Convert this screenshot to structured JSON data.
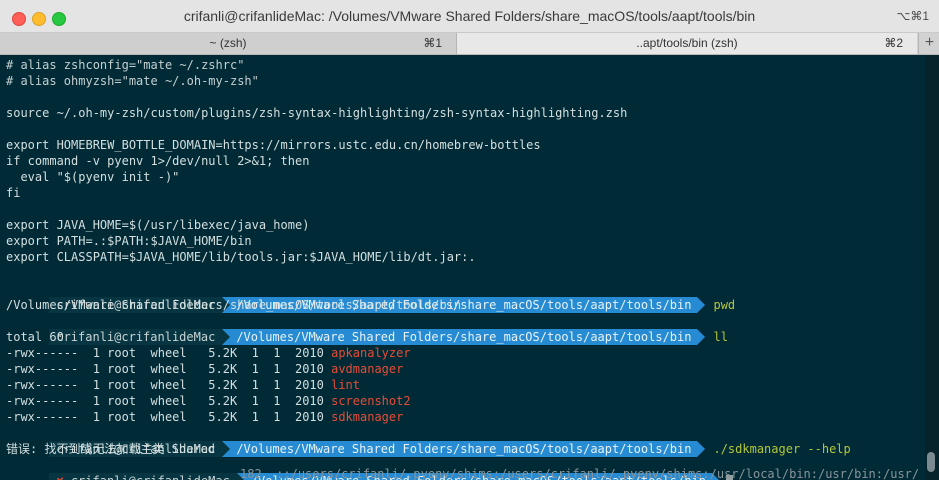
{
  "window": {
    "title": "crifanli@crifanlideMac: /Volumes/VMware Shared Folders/share_macOS/tools/aapt/tools/bin",
    "shortcut": "⌥⌘1"
  },
  "tabs": [
    {
      "label": "~ (zsh)",
      "shortcut": "⌘1"
    },
    {
      "label": "..apt/tools/bin (zsh)",
      "shortcut": "⌘2"
    }
  ],
  "tab_add": "+",
  "terminal": {
    "c1": "# alias zshconfig=\"mate ~/.zshrc\"",
    "c2": "# alias ohmyzsh=\"mate ~/.oh-my-zsh\"",
    "src": "source ~/.oh-my-zsh/custom/plugins/zsh-syntax-highlighting/zsh-syntax-highlighting.zsh",
    "brew": "export HOMEBREW_BOTTLE_DOMAIN=https://mirrors.ustc.edu.cn/homebrew-bottles",
    "if": "if command -v pyenv 1>/dev/null 2>&1; then",
    "eval": "  eval \"$(pyenv init -)\"",
    "fi": "fi",
    "java": "export JAVA_HOME=$(/usr/libexec/java_home)",
    "path": "export PATH=.:$PATH:$JAVA_HOME/bin",
    "cp": "export CLASSPATH=$JAVA_HOME/lib/tools.jar:$JAVA_HOME/lib/dt.jar:.",
    "prompt_user": "crifanli@crifanlideMac",
    "prompt_dir": "/Volumes/VMware Shared Folders/share_macOS/tools/aapt/tools/bin",
    "cmd_pwd": "pwd",
    "pwd_out": "/Volumes/VMware Shared Folders/share_macOS/tools/aapt/tools/bin",
    "cmd_ll": "ll",
    "total": "total 60",
    "files": [
      {
        "meta": "-rwx------  1 root  wheel   5.2K  1  1  2010 ",
        "name": "apkanalyzer"
      },
      {
        "meta": "-rwx------  1 root  wheel   5.2K  1  1  2010 ",
        "name": "avdmanager"
      },
      {
        "meta": "-rwx------  1 root  wheel   5.2K  1  1  2010 ",
        "name": "lint"
      },
      {
        "meta": "-rwx------  1 root  wheel   5.2K  1  1  2010 ",
        "name": "screenshot2"
      },
      {
        "meta": "-rwx------  1 root  wheel   5.2K  1  1  2010 ",
        "name": "sdkmanager"
      }
    ],
    "cmd_sdk": "./sdkmanager --help",
    "error": "错误: 找不到或无法加载主类 Shared",
    "cross": "✘"
  },
  "background_window_text": "::/users/crifanli/.pyenv/shims:/users/crifanli/.pyenv/shims:/usr/local/bin:/usr/bin:/usr/",
  "background_window_lineno": "182",
  "colors": {
    "background": "#002b36",
    "prompt_user_bg": "#073642",
    "prompt_dir_bg": "#268bd2",
    "command": "#b4c53a",
    "executable": "#e64c35"
  }
}
